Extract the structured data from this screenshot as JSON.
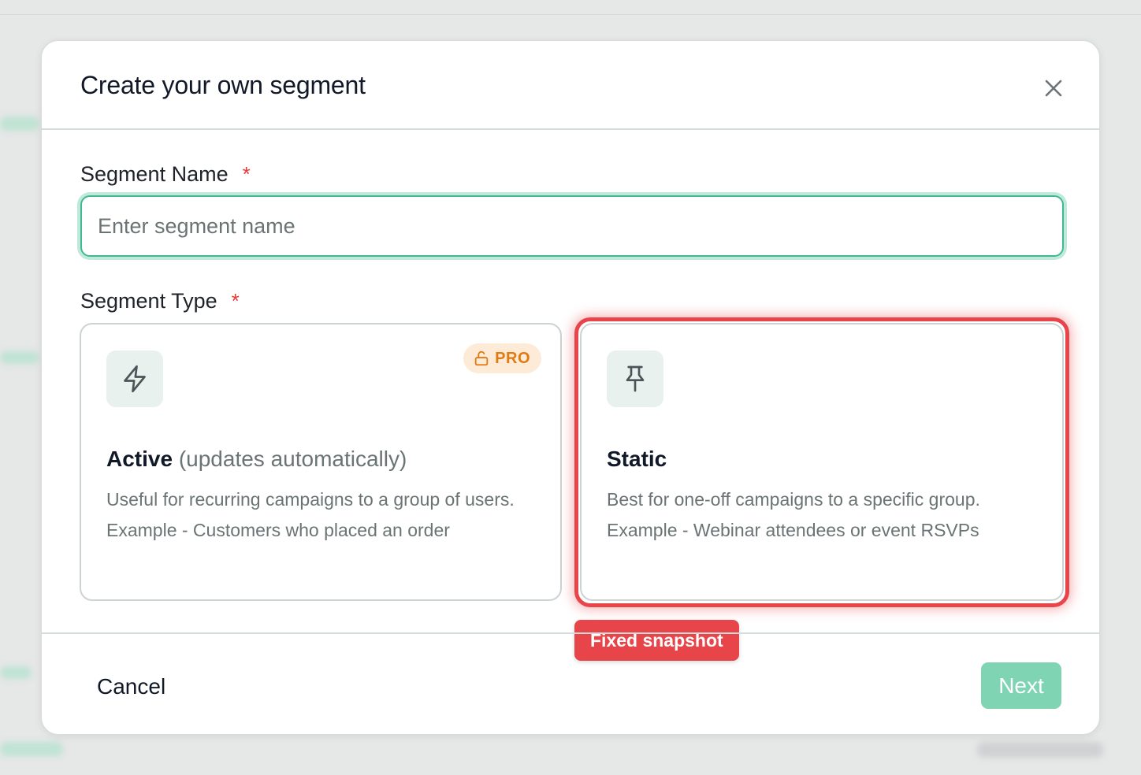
{
  "modal": {
    "title": "Create your own segment",
    "close_icon": "close-icon"
  },
  "segment_name": {
    "label": "Segment Name",
    "required_mark": "*",
    "placeholder": "Enter segment name",
    "value": ""
  },
  "segment_type": {
    "label": "Segment Type",
    "required_mark": "*",
    "options": [
      {
        "icon": "lightning-icon",
        "badge_icon": "unlock-icon",
        "badge": "PRO",
        "title": "Active",
        "subtitle": "(updates automatically)",
        "description": "Useful for recurring campaigns to a group of users. Example - Customers who placed an order"
      },
      {
        "icon": "pin-icon",
        "title": "Static",
        "description": "Best for one-off campaigns to a specific group. Example - Webinar attendees or event RSVPs",
        "annotation": "Fixed snapshot"
      }
    ]
  },
  "footer": {
    "cancel_label": "Cancel",
    "next_label": "Next"
  },
  "colors": {
    "accent": "#40b992",
    "next_button": "#7fd4b4",
    "annotation": "#e8454a",
    "pro_badge_text": "#e07b12",
    "pro_badge_bg": "#fdebd8"
  }
}
